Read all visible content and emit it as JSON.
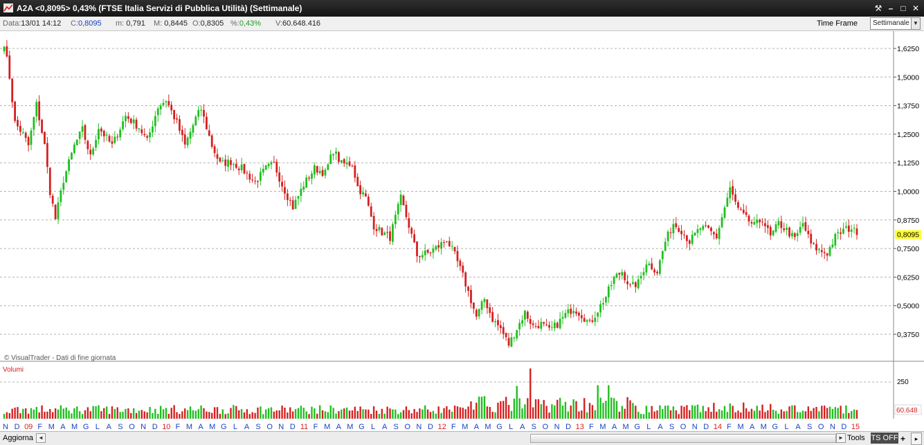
{
  "window": {
    "title": "A2A <0,8095> 0,43%  (FTSE Italia Servizi di Pubblica Utilità)  (Settimanale)",
    "buttons": {
      "tools": "⚒",
      "minimize": "–",
      "maximize": "□",
      "close": "✕"
    }
  },
  "infobar": {
    "data_label": "Data:",
    "data_value": "13/01 14:12",
    "c_label": "C:",
    "c_value": "0,8095",
    "m_label": "m:",
    "m_value": "0,791",
    "M_label": "M:",
    "M_value": "0,8445",
    "o_label": "O:",
    "o_value": "0,8305",
    "pct_label": "%:",
    "pct_value": "0,43%",
    "v_label": "V:",
    "v_value": "60.648.416",
    "timeframe_label": "Time Frame",
    "timeframe_value": "Settimanale"
  },
  "chart_data": {
    "type": "candlestick",
    "ylim": [
      0.3125,
      1.6875
    ],
    "y_ticks": [
      "1,6250",
      "1,5000",
      "1,3750",
      "1,2500",
      "1,1250",
      "1,0000",
      "0,8750",
      "0,7500",
      "0,6250",
      "0,5000",
      "0,3750"
    ],
    "y_tick_values": [
      1.625,
      1.5,
      1.375,
      1.25,
      1.125,
      1.0,
      0.875,
      0.75,
      0.625,
      0.5,
      0.375
    ],
    "last_price_label": "0,8095",
    "last_price": 0.8095,
    "watermark": "© VisualTrader - Dati di fine giornata",
    "volume_title": "Volumi",
    "volume_tick": "250",
    "volume_tick_value": 250,
    "volume_last_label": "60.648",
    "volume_last": 60.648,
    "anchors": [
      [
        0,
        1.65
      ],
      [
        2,
        1.5
      ],
      [
        4,
        1.3
      ],
      [
        7,
        1.25
      ],
      [
        9,
        1.2
      ],
      [
        12,
        1.38
      ],
      [
        15,
        1.2
      ],
      [
        17,
        1.0
      ],
      [
        19,
        0.88
      ],
      [
        22,
        1.05
      ],
      [
        26,
        1.2
      ],
      [
        29,
        1.27
      ],
      [
        32,
        1.15
      ],
      [
        35,
        1.28
      ],
      [
        40,
        1.2
      ],
      [
        45,
        1.33
      ],
      [
        50,
        1.28
      ],
      [
        53,
        1.22
      ],
      [
        57,
        1.37
      ],
      [
        60,
        1.4
      ],
      [
        64,
        1.3
      ],
      [
        67,
        1.2
      ],
      [
        71,
        1.32
      ],
      [
        73,
        1.36
      ],
      [
        77,
        1.2
      ],
      [
        80,
        1.12
      ],
      [
        84,
        1.13
      ],
      [
        88,
        1.1
      ],
      [
        93,
        1.04
      ],
      [
        97,
        1.1
      ],
      [
        100,
        1.12
      ],
      [
        103,
        1.03
      ],
      [
        107,
        0.93
      ],
      [
        111,
        1.03
      ],
      [
        115,
        1.1
      ],
      [
        119,
        1.08
      ],
      [
        122,
        1.18
      ],
      [
        125,
        1.12
      ],
      [
        129,
        1.12
      ],
      [
        131,
        1.02
      ],
      [
        134,
        0.97
      ],
      [
        137,
        0.85
      ],
      [
        140,
        0.82
      ],
      [
        143,
        0.8
      ],
      [
        147,
        0.97
      ],
      [
        150,
        0.85
      ],
      [
        153,
        0.72
      ],
      [
        157,
        0.73
      ],
      [
        161,
        0.76
      ],
      [
        164,
        0.79
      ],
      [
        167,
        0.72
      ],
      [
        170,
        0.63
      ],
      [
        172,
        0.56
      ],
      [
        175,
        0.45
      ],
      [
        178,
        0.53
      ],
      [
        181,
        0.44
      ],
      [
        184,
        0.4
      ],
      [
        187,
        0.33
      ],
      [
        190,
        0.4
      ],
      [
        193,
        0.47
      ],
      [
        196,
        0.41
      ],
      [
        199,
        0.42
      ],
      [
        202,
        0.39
      ],
      [
        205,
        0.42
      ],
      [
        208,
        0.46
      ],
      [
        211,
        0.49
      ],
      [
        214,
        0.46
      ],
      [
        217,
        0.42
      ],
      [
        220,
        0.48
      ],
      [
        223,
        0.54
      ],
      [
        226,
        0.62
      ],
      [
        229,
        0.65
      ],
      [
        232,
        0.58
      ],
      [
        235,
        0.6
      ],
      [
        238,
        0.69
      ],
      [
        242,
        0.65
      ],
      [
        245,
        0.78
      ],
      [
        248,
        0.86
      ],
      [
        251,
        0.83
      ],
      [
        254,
        0.78
      ],
      [
        258,
        0.84
      ],
      [
        261,
        0.83
      ],
      [
        264,
        0.8
      ],
      [
        267,
        0.93
      ],
      [
        269,
        1.01
      ],
      [
        272,
        0.92
      ],
      [
        275,
        0.88
      ],
      [
        278,
        0.85
      ],
      [
        281,
        0.88
      ],
      [
        284,
        0.8
      ],
      [
        287,
        0.86
      ],
      [
        290,
        0.83
      ],
      [
        293,
        0.79
      ],
      [
        296,
        0.86
      ],
      [
        299,
        0.77
      ],
      [
        302,
        0.74
      ],
      [
        305,
        0.73
      ],
      [
        308,
        0.8
      ],
      [
        311,
        0.83
      ],
      [
        314,
        0.84
      ],
      [
        316,
        0.81
      ]
    ],
    "x_labels": [
      {
        "text": "N",
        "type": "month"
      },
      {
        "text": "D",
        "type": "month"
      },
      {
        "text": "09",
        "type": "year"
      },
      {
        "text": "F",
        "type": "month"
      },
      {
        "text": "M",
        "type": "month"
      },
      {
        "text": "A",
        "type": "month"
      },
      {
        "text": "M",
        "type": "month"
      },
      {
        "text": "G",
        "type": "month"
      },
      {
        "text": "L",
        "type": "month"
      },
      {
        "text": "A",
        "type": "month"
      },
      {
        "text": "S",
        "type": "month"
      },
      {
        "text": "O",
        "type": "month"
      },
      {
        "text": "N",
        "type": "month"
      },
      {
        "text": "D",
        "type": "month"
      },
      {
        "text": "10",
        "type": "year"
      },
      {
        "text": "F",
        "type": "month"
      },
      {
        "text": "M",
        "type": "month"
      },
      {
        "text": "A",
        "type": "month"
      },
      {
        "text": "M",
        "type": "month"
      },
      {
        "text": "G",
        "type": "month"
      },
      {
        "text": "L",
        "type": "month"
      },
      {
        "text": "A",
        "type": "month"
      },
      {
        "text": "S",
        "type": "month"
      },
      {
        "text": "O",
        "type": "month"
      },
      {
        "text": "N",
        "type": "month"
      },
      {
        "text": "D",
        "type": "month"
      },
      {
        "text": "11",
        "type": "year"
      },
      {
        "text": "F",
        "type": "month"
      },
      {
        "text": "M",
        "type": "month"
      },
      {
        "text": "A",
        "type": "month"
      },
      {
        "text": "M",
        "type": "month"
      },
      {
        "text": "G",
        "type": "month"
      },
      {
        "text": "L",
        "type": "month"
      },
      {
        "text": "A",
        "type": "month"
      },
      {
        "text": "S",
        "type": "month"
      },
      {
        "text": "O",
        "type": "month"
      },
      {
        "text": "N",
        "type": "month"
      },
      {
        "text": "D",
        "type": "month"
      },
      {
        "text": "12",
        "type": "year"
      },
      {
        "text": "F",
        "type": "month"
      },
      {
        "text": "M",
        "type": "month"
      },
      {
        "text": "A",
        "type": "month"
      },
      {
        "text": "M",
        "type": "month"
      },
      {
        "text": "G",
        "type": "month"
      },
      {
        "text": "L",
        "type": "month"
      },
      {
        "text": "A",
        "type": "month"
      },
      {
        "text": "S",
        "type": "month"
      },
      {
        "text": "O",
        "type": "month"
      },
      {
        "text": "N",
        "type": "month"
      },
      {
        "text": "D",
        "type": "month"
      },
      {
        "text": "13",
        "type": "year"
      },
      {
        "text": "F",
        "type": "month"
      },
      {
        "text": "M",
        "type": "month"
      },
      {
        "text": "A",
        "type": "month"
      },
      {
        "text": "M",
        "type": "month"
      },
      {
        "text": "G",
        "type": "month"
      },
      {
        "text": "L",
        "type": "month"
      },
      {
        "text": "A",
        "type": "month"
      },
      {
        "text": "S",
        "type": "month"
      },
      {
        "text": "O",
        "type": "month"
      },
      {
        "text": "N",
        "type": "month"
      },
      {
        "text": "D",
        "type": "month"
      },
      {
        "text": "14",
        "type": "year"
      },
      {
        "text": "F",
        "type": "month"
      },
      {
        "text": "M",
        "type": "month"
      },
      {
        "text": "A",
        "type": "month"
      },
      {
        "text": "M",
        "type": "month"
      },
      {
        "text": "G",
        "type": "month"
      },
      {
        "text": "L",
        "type": "month"
      },
      {
        "text": "A",
        "type": "month"
      },
      {
        "text": "S",
        "type": "month"
      },
      {
        "text": "O",
        "type": "month"
      },
      {
        "text": "N",
        "type": "month"
      },
      {
        "text": "D",
        "type": "month"
      },
      {
        "text": "15",
        "type": "year"
      }
    ],
    "colors": {
      "up": "#1fbf1f",
      "down": "#d42020",
      "month_label": "#1a3fbf",
      "year_label": "#d42020",
      "last_price_bg": "#ffff33",
      "grid": "#b0b0b0"
    }
  },
  "bottombar": {
    "aggiorna": "Aggiorna",
    "tools": "Tools",
    "ts_off": "TS OFF",
    "plus": "+",
    "scroll_left": "◄",
    "scroll_right": "►",
    "mini": "▸"
  }
}
